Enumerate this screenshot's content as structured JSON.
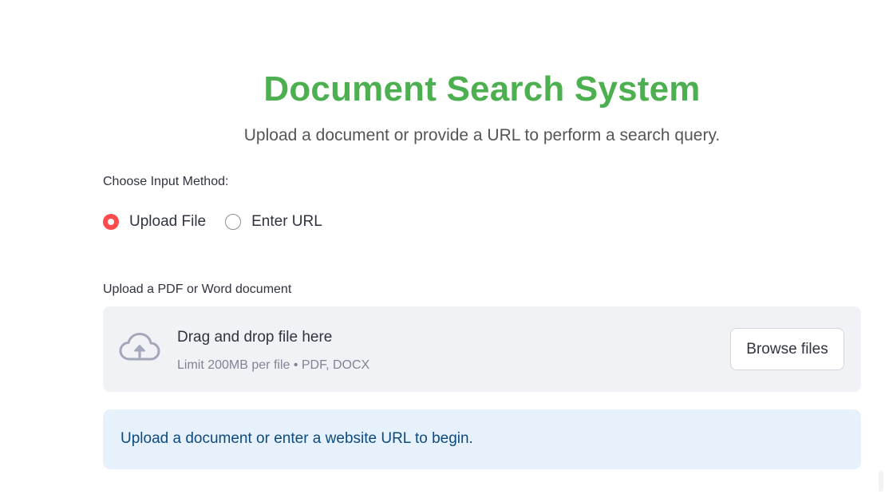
{
  "header": {
    "title": "Document Search System",
    "subtitle": "Upload a document or provide a URL to perform a search query."
  },
  "input_method": {
    "label": "Choose Input Method:",
    "options": [
      {
        "label": "Upload File",
        "selected": true
      },
      {
        "label": "Enter URL",
        "selected": false
      }
    ]
  },
  "uploader": {
    "label": "Upload a PDF or Word document",
    "drop_text": "Drag and drop file here",
    "limit_text": "Limit 200MB per file • PDF, DOCX",
    "browse_label": "Browse files",
    "icon": "cloud-upload-icon"
  },
  "info": {
    "message": "Upload a document or enter a website URL to begin."
  },
  "colors": {
    "title": "#4caf50",
    "radio_selected": "#ff4b4b",
    "dropzone_bg": "#f0f2f6",
    "info_bg": "#e6f1fb",
    "info_text": "#0e4a80"
  }
}
